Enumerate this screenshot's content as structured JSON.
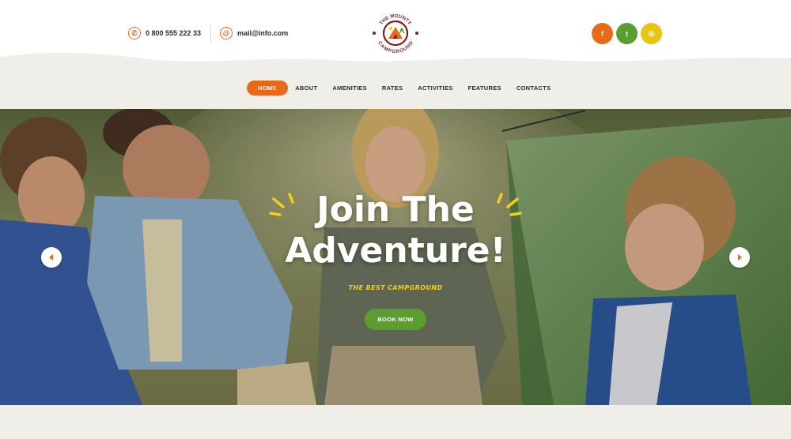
{
  "header": {
    "phone": "0 800 555 222 33",
    "email": "mail@info.com",
    "logo_text_top": "THE MOUNTY",
    "logo_text_bottom": "CAMPGROUND",
    "social": [
      {
        "name": "facebook",
        "glyph": "f",
        "color": "#e8691a"
      },
      {
        "name": "twitter",
        "glyph": "t",
        "color": "#5a9e2f"
      },
      {
        "name": "instagram",
        "glyph": "◎",
        "color": "#e8c414"
      }
    ]
  },
  "nav": {
    "items": [
      "HOME",
      "ABOUT",
      "AMENITIES",
      "RATES",
      "ACTIVITIES",
      "FEATURES",
      "CONTACTS"
    ],
    "active": "HOME"
  },
  "hero": {
    "title_line1": "Join The",
    "title_line2": "Adventure!",
    "subtitle": "THE BEST CAMPGROUND",
    "cta": "BOOK NOW"
  },
  "colors": {
    "accent_orange": "#e8691a",
    "accent_green": "#5a9e2f",
    "accent_yellow": "#f3cf16"
  }
}
